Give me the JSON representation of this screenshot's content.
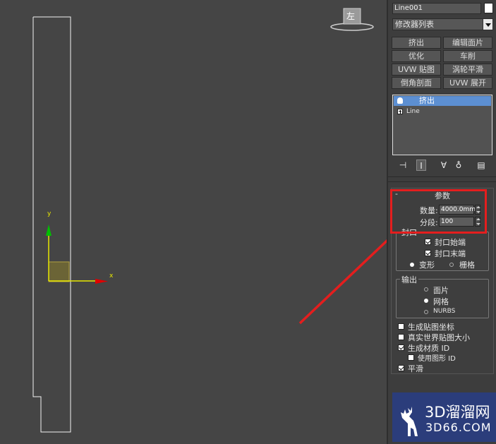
{
  "viewport": {
    "gizmo_y_label": "y",
    "gizmo_x_label": "x",
    "viewcube_label": "左"
  },
  "command_panel": {
    "object_name": "Line001",
    "object_color": "#ffffff",
    "modifier_list_label": "修改器列表",
    "modifier_buttons": [
      "挤出",
      "编辑面片",
      "优化",
      "车削",
      "UVW 贴图",
      "涡轮平滑",
      "倒角剖面",
      "UVW 展开"
    ],
    "stack_items": [
      "挤出",
      "Line"
    ]
  },
  "parameters": {
    "title": "参数",
    "amount_label": "数量:",
    "amount_value": "4000.0mm",
    "segments_label": "分段:",
    "segments_value": "100",
    "capping": {
      "title": "封口",
      "cap_start": "封口始端",
      "cap_end": "封口末端",
      "morph": "变形",
      "grid": "栅格"
    },
    "output": {
      "title": "输出",
      "patch": "面片",
      "mesh": "网格",
      "nurbs": "NURBS"
    },
    "gen_map_coords": "生成贴图坐标",
    "real_world_map": "真实世界贴图大小",
    "gen_mat_ids": "生成材质 ID",
    "use_shape_ids": "使用图形 ID",
    "smooth": "平滑"
  },
  "watermark": {
    "main": "3D溜溜网",
    "sub": "3D66.COM"
  },
  "colors": {
    "highlight_red": "#e41e1e",
    "selection_blue": "#5c8fd2",
    "gizmo_yellow": "#e8e800",
    "gizmo_green": "#00c000",
    "gizmo_red": "#e00000"
  }
}
